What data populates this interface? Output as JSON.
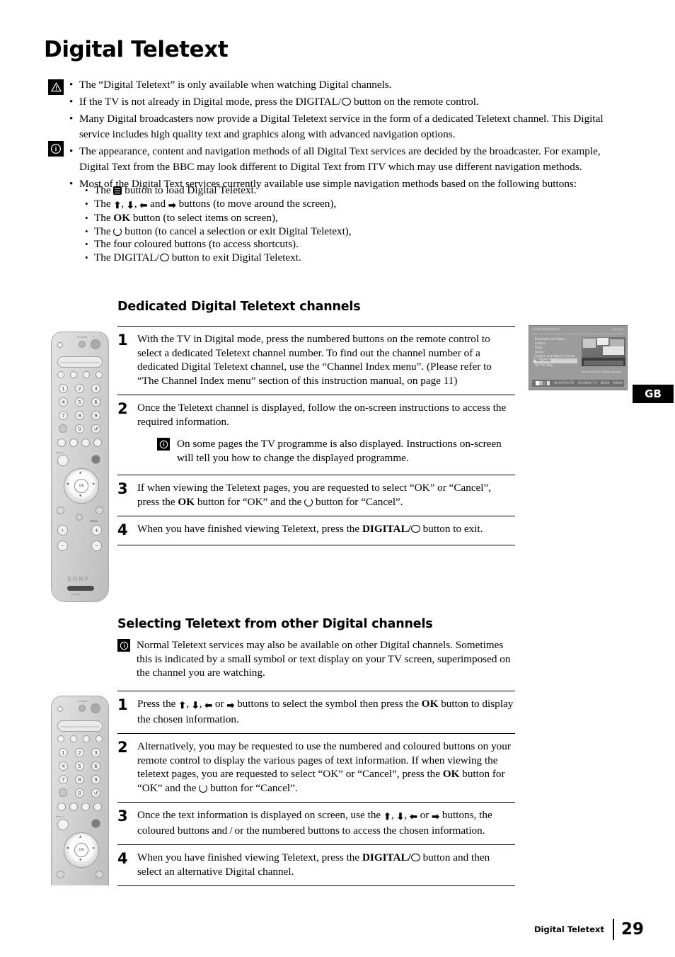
{
  "document": {
    "title": "Digital Teletext",
    "footer_label": "Digital Teletext",
    "page_number": "29",
    "region_badge": "GB"
  },
  "intro": {
    "bullets": [
      "The “Digital Teletext” is only available when watching Digital channels.",
      "If the TV is not already in Digital mode, press the DIGITAL/ ◯ button on the remote control.",
      "Many Digital broadcasters now provide a Digital Teletext service in the form of a dedicated Teletext channel. This Digital service includes high quality text and graphics along with advanced navigation options.",
      "The appearance, content and navigation methods of all Digital Text services are decided by the broadcaster. For example, Digital Text from the BBC may look different to Digital Text from ITV which may use different navigation methods.",
      "Most of the Digital Text services currently available use simple navigation methods based on the following buttons:"
    ],
    "sub_bullets": [
      "The ☰ button to load Digital Teletext.",
      "The ⬆, ⬇, ⬅ and ➡ buttons (to move around the screen),",
      "The OK button (to select items on screen),",
      "The ↺ button (to cancel a selection or exit Digital Teletext),",
      "The four coloured buttons (to access shortcuts).",
      "The DIGITAL/ ◯ button to exit Digital Teletext."
    ]
  },
  "section1": {
    "heading": "Dedicated Digital Teletext channels",
    "steps": [
      {
        "number": "1",
        "text": "With the TV in Digital mode, press the numbered buttons on the remote control to select a dedicated Teletext channel number. To find out the channel number of a dedicated Digital Teletext channel, use the “Channel Index menu”. (Please refer to “The Channel Index menu” section of this instruction manual, on page 11)"
      },
      {
        "number": "2",
        "text": "Once the Teletext channel is displayed, follow the on-screen instructions to access the required information.",
        "note": "On some pages the TV programme is also displayed. Instructions on-screen will tell you how to change the displayed programme."
      },
      {
        "number": "3",
        "text": "If when viewing the Teletext pages, you are requested to select “OK” or “Cancel”, press the OK button for “OK” and the ↺ button for “Cancel”."
      },
      {
        "number": "4",
        "text": "When you have finished viewing Teletext, press the DIGITAL/ ◯ button to exit."
      }
    ]
  },
  "section2": {
    "heading": "Selecting Teletext from other Digital channels",
    "intro_note": "Normal Teletext services may also be available on other Digital channels. Sometimes this is indicated by a small symbol or text display on your TV screen, superimposed on the channel you are watching.",
    "steps": [
      {
        "number": "1",
        "text": "Press the ⬆, ⬇, ⬅ or ➡ buttons to select the symbol then press the OK button to display the chosen information."
      },
      {
        "number": "2",
        "text": "Alternatively, you may be requested to use the numbered and coloured buttons on your remote control to display the various pages of text information. If when viewing the teletext pages, you are requested to select “OK” or “Cancel”, press the OK button for “OK” and the ↺ button for “Cancel”."
      },
      {
        "number": "3",
        "text": "Once the text information is displayed on screen, use the ⬆, ⬇, ⬅ or ➡ buttons, the coloured buttons and/or the numbered buttons to access the chosen information."
      },
      {
        "number": "4",
        "text": "When you have finished viewing Teletext, press the DIGITAL/ ◯ button and then select an alternative Digital channel."
      }
    ]
  },
  "tv_screenshot": {
    "title": "Entertainment",
    "top_right": "text  time",
    "menu_items": [
      "Entertainment News",
      "Lottery",
      "Films",
      "Soaps",
      "Singles and Albums Charts",
      "Web Guide",
      "On This Day"
    ],
    "selected_item": "Web Guide",
    "hint": "Press BLUE to change section.",
    "bottom_bar": [
      "SHORTCUTS",
      "CHANGE TV",
      "BACK",
      "MENU"
    ]
  },
  "remote": {
    "brand": "SONY",
    "number_keys": [
      "1",
      "2",
      "3",
      "4",
      "5",
      "6",
      "7",
      "8",
      "9",
      "0"
    ],
    "ok_label": "OK",
    "prog_label": "PROG",
    "prog_plus": "+",
    "prog_minus": "−",
    "menu_label": "MENU/◯"
  }
}
